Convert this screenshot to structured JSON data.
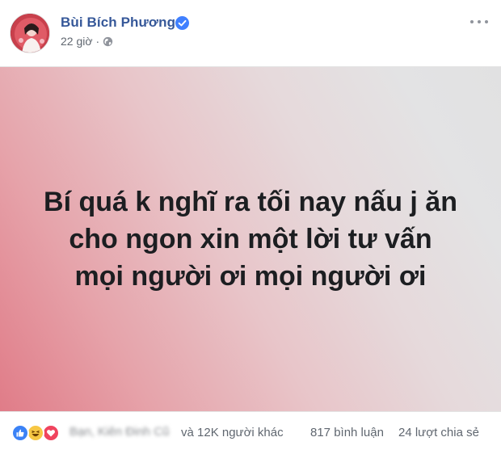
{
  "post": {
    "author": "Bùi Bích Phương",
    "timestamp": "22 giờ",
    "separator": "·",
    "privacy_icon": "globe-icon",
    "verified_icon": "verified-badge-icon",
    "menu_icon": "more-options-icon"
  },
  "status": {
    "text": "Bí quá k nghĩ ra tối nay nấu j ăn\ncho ngon xin một lời tư vấn\nmọi người ơi mọi người ơi",
    "background_gradient": [
      "#e07c88",
      "#e8c5c9",
      "#e1e1e2"
    ]
  },
  "footer": {
    "reactions": [
      "like",
      "haha",
      "love"
    ],
    "reacted_names_blurred": "Bạn, Kiên Đinh Cũ",
    "others": "và 12K người khác",
    "comments": "817 bình luận",
    "shares": "24 lượt chia sẻ"
  },
  "colors": {
    "name": "#365899",
    "meta": "#606770",
    "verified": "#4080ff",
    "like": "#3b82f6",
    "haha": "#f7c744",
    "love": "#f0445e"
  }
}
